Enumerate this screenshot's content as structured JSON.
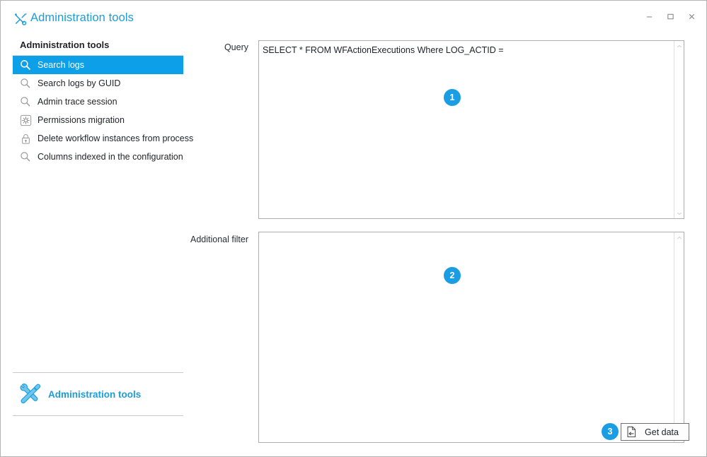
{
  "window": {
    "title": "Administration tools",
    "title_icon": "tools-crossed-icon",
    "controls": {
      "minimize": "–",
      "maximize": "☐",
      "close": "✕"
    },
    "accent_color": "#1b9ddb",
    "selection_color": "#0d9fe8",
    "badge_color": "#1b9de4"
  },
  "sidebar": {
    "header": "Administration tools",
    "items": [
      {
        "label": "Search logs",
        "icon": "search-icon",
        "selected": true
      },
      {
        "label": "Search logs by GUID",
        "icon": "search-icon",
        "selected": false
      },
      {
        "label": "Admin trace session",
        "icon": "search-icon",
        "selected": false
      },
      {
        "label": "Permissions migration",
        "icon": "gear-icon",
        "selected": false
      },
      {
        "label": "Delete workflow instances from process",
        "icon": "lock-icon",
        "selected": false
      },
      {
        "label": "Columns indexed in the configuration",
        "icon": "search-icon",
        "selected": false
      }
    ],
    "footer": {
      "label": "Administration tools",
      "icon": "tools-crossed-icon"
    }
  },
  "main": {
    "query": {
      "label": "Query",
      "value": "SELECT * FROM WFActionExecutions Where LOG_ACTID =",
      "placeholder": "",
      "badge": "1",
      "scroll_up_icon": "chevron-up-icon",
      "scroll_down_icon": "chevron-down-icon"
    },
    "additional_filter": {
      "label": "Additional filter",
      "value": "",
      "placeholder": "",
      "badge": "2",
      "scroll_up_icon": "chevron-up-icon",
      "scroll_down_icon": "chevron-down-icon"
    },
    "actions": {
      "badge": "3",
      "get_data_label": "Get data",
      "get_data_icon": "document-import-icon"
    }
  }
}
